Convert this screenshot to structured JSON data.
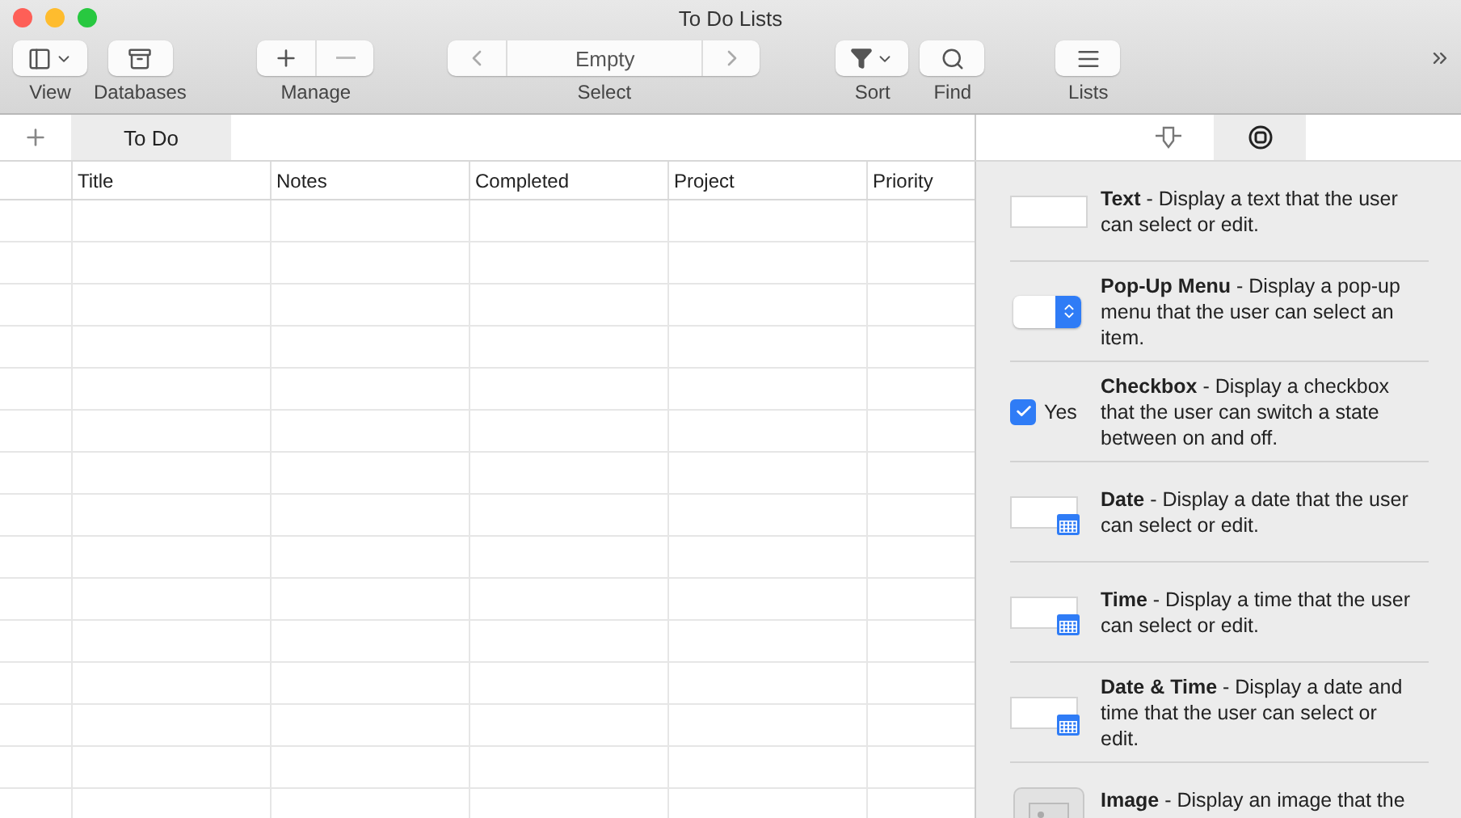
{
  "window": {
    "title": "To Do Lists"
  },
  "toolbar": [
    {
      "kind": "view",
      "label": "View"
    },
    {
      "kind": "databases",
      "label": "Databases"
    },
    {
      "kind": "manage",
      "label": "Manage"
    },
    {
      "kind": "select",
      "label": "Select",
      "value": "Empty"
    },
    {
      "kind": "sort",
      "label": "Sort"
    },
    {
      "kind": "find",
      "label": "Find"
    },
    {
      "kind": "lists",
      "label": "Lists"
    }
  ],
  "tabs": [
    {
      "label": "To Do",
      "selected": true
    }
  ],
  "table": {
    "columns": [
      "Title",
      "Notes",
      "Completed",
      "Project",
      "Priority"
    ]
  },
  "inspector": {
    "tabs": [
      {
        "kind": "fields",
        "selected": false
      },
      {
        "kind": "field-types",
        "selected": true
      }
    ],
    "field_types": [
      {
        "kind": "text",
        "description": "**Text** - Display a text that the user can select or edit."
      },
      {
        "kind": "popup",
        "description": "**Pop-Up Menu** - Display a pop-up menu that the user can select an item."
      },
      {
        "kind": "checkbox",
        "checked": true,
        "label": "Yes",
        "description": "**Checkbox** - Display a checkbox that the user can switch a state between on and off."
      },
      {
        "kind": "date",
        "description": "**Date** - Display a date that the user can select or edit."
      },
      {
        "kind": "time",
        "description": "**Time** - Display a time that the user can select or edit."
      },
      {
        "kind": "datetime",
        "description": "**Date & Time** - Display a date and time that the user can select or edit."
      },
      {
        "kind": "image",
        "description": "**Image** - Display an image that the"
      }
    ]
  }
}
